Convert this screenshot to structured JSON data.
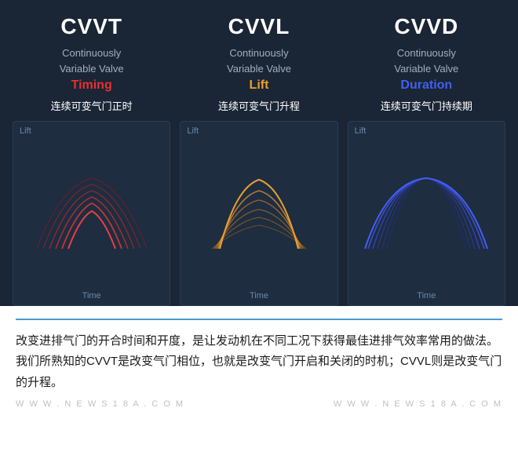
{
  "cards": [
    {
      "title": "CVVT",
      "line1": "Continuously",
      "line2": "Variable Valve",
      "highlight": "Timing",
      "highlight_class": "highlight-red",
      "chinese": "连续可变气门正时",
      "lift_label": "Lift",
      "time_label": "Time",
      "chart_type": "red"
    },
    {
      "title": "CVVL",
      "line1": "Continuously",
      "line2": "Variable Valve",
      "highlight": "Lift",
      "highlight_class": "highlight-yellow",
      "chinese": "连续可变气门升程",
      "lift_label": "Lift",
      "time_label": "Time",
      "chart_type": "yellow"
    },
    {
      "title": "CVVD",
      "line1": "Continuously",
      "line2": "Variable Valve",
      "highlight": "Duration",
      "highlight_class": "highlight-blue",
      "chinese": "连续可变气门持续期",
      "lift_label": "Lift",
      "time_label": "Time",
      "chart_type": "blue"
    }
  ],
  "bottom_text": "改变进排气门的开合时间和开度，是让发动机在不同工况下获得最佳进排气效率常用的做法。我们所熟知的CVVT是改变气门相位，也就是改变气门开启和关闭的时机；CVVL则是改变气门的升程。",
  "watermarks": [
    "W W W . N E W S 1 8 A . C O M",
    "W W W . N E W S 1 8 A . C O M"
  ]
}
